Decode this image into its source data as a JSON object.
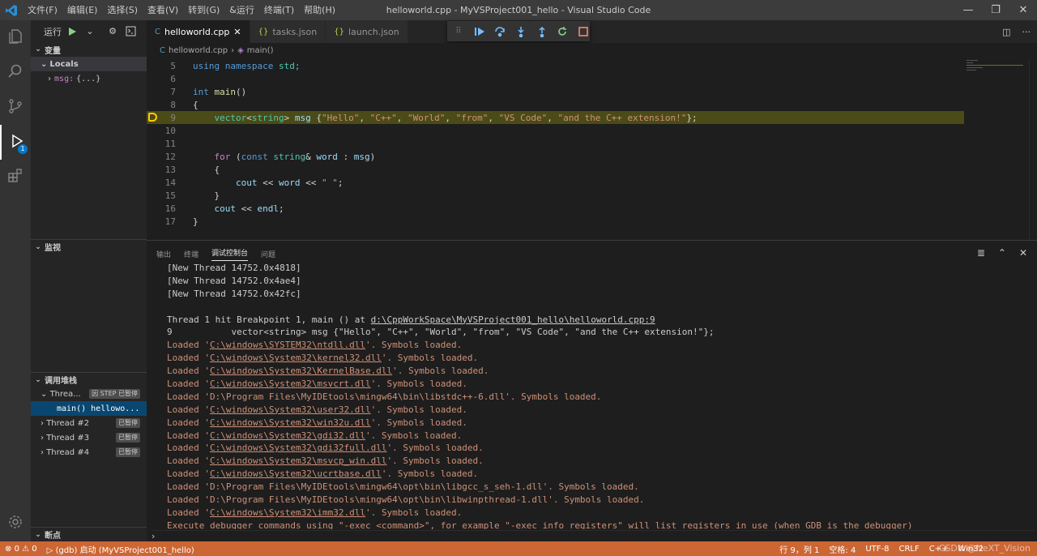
{
  "window": {
    "title": "helloworld.cpp - MyVSProject001_hello - Visual Studio Code",
    "menu": [
      "文件(F)",
      "编辑(E)",
      "选择(S)",
      "查看(V)",
      "转到(G)",
      "&运行",
      "终端(T)",
      "帮助(H)"
    ],
    "controls": {
      "minimize": "—",
      "maximize": "❐",
      "close": "✕"
    }
  },
  "activity": {
    "debug_badge": "1"
  },
  "sidebar": {
    "run_label": "运行",
    "variables_title": "变量",
    "locals_label": "Locals",
    "msg_name": "msg:",
    "msg_value": "{...}",
    "watch_title": "监视",
    "callstack_title": "调用堆栈",
    "threads": [
      {
        "label": "Threa...",
        "status": "因 STEP 已暂停"
      },
      {
        "label": "Thread #2",
        "status": "已暂停"
      },
      {
        "label": "Thread #3",
        "status": "已暂停"
      },
      {
        "label": "Thread #4",
        "status": "已暂停"
      }
    ],
    "frame_fn": "main()",
    "frame_file": "hellowo...",
    "breakpoints_title": "断点"
  },
  "tabs": [
    {
      "label": "helloworld.cpp",
      "icon": "C++",
      "active": true
    },
    {
      "label": "tasks.json",
      "icon": "{}"
    },
    {
      "label": "launch.json",
      "icon": "{}"
    }
  ],
  "breadcrumb": {
    "file": "helloworld.cpp",
    "symbol": "main()"
  },
  "editor": {
    "current_line": 9,
    "lines": [
      {
        "n": "5"
      },
      {
        "n": "6"
      },
      {
        "n": "7"
      },
      {
        "n": "8"
      },
      {
        "n": "9"
      },
      {
        "n": "10"
      },
      {
        "n": "11"
      },
      {
        "n": "12"
      },
      {
        "n": "13"
      },
      {
        "n": "14"
      },
      {
        "n": "15"
      },
      {
        "n": "16"
      },
      {
        "n": "17"
      }
    ],
    "tokens": {
      "l5_a": "using",
      "l5_b": "namespace",
      "l5_c": "std;",
      "l7_a": "int",
      "l7_b": "main",
      "l9_a": "vector",
      "l9_b": "string",
      "l9_c": "msg",
      "l9_s1": "\"Hello\"",
      "l9_s2": "\"C++\"",
      "l9_s3": "\"World\"",
      "l9_s4": "\"from\"",
      "l9_s5": "\"VS Code\"",
      "l9_s6": "\"and the C++ extension!\"",
      "l12_a": "for",
      "l12_b": "const",
      "l12_c": "string",
      "l12_d": "word",
      "l12_e": "msg",
      "l14_a": "cout",
      "l14_b": "word",
      "l14_s": "\" \"",
      "l16_a": "cout",
      "l16_b": "endl"
    }
  },
  "panel": {
    "tabs": [
      "输出",
      "终端",
      "调试控制台",
      "问题"
    ],
    "active_tab": "调试控制台",
    "console": [
      {
        "text": "[New Thread 14752.0x4818]",
        "color": "white"
      },
      {
        "text": "[New Thread 14752.0x4ae4]",
        "color": "white"
      },
      {
        "text": "[New Thread 14752.0x42fc]",
        "color": "white"
      },
      {
        "text": "",
        "color": "white"
      },
      {
        "text": "Thread 1 hit Breakpoint 1, main () at ",
        "link": "d:\\CppWorkSpace\\MyVSProject001_hello\\helloworld.cpp:9",
        "color": "white"
      },
      {
        "text": "9\t    vector<string> msg {\"Hello\", \"C++\", \"World\", \"from\", \"VS Code\", \"and the C++ extension!\"};",
        "color": "white"
      },
      {
        "pre": "Loaded '",
        "link": "C:\\windows\\SYSTEM32\\ntdll.dll",
        "post": "'. Symbols loaded.",
        "color": "orange"
      },
      {
        "pre": "Loaded '",
        "link": "C:\\windows\\System32\\kernel32.dll",
        "post": "'. Symbols loaded.",
        "color": "orange"
      },
      {
        "pre": "Loaded '",
        "link": "C:\\windows\\System32\\KernelBase.dll",
        "post": "'. Symbols loaded.",
        "color": "orange"
      },
      {
        "pre": "Loaded '",
        "link": "C:\\windows\\System32\\msvcrt.dll",
        "post": "'. Symbols loaded.",
        "color": "orange"
      },
      {
        "pre": "Loaded 'D:\\Program Files\\MyIDEtools\\mingw64\\bin\\libstdc++-6.dll'. Symbols loaded.",
        "link": "",
        "post": "",
        "color": "orange"
      },
      {
        "pre": "Loaded '",
        "link": "C:\\windows\\System32\\user32.dll",
        "post": "'. Symbols loaded.",
        "color": "orange"
      },
      {
        "pre": "Loaded '",
        "link": "C:\\windows\\System32\\win32u.dll",
        "post": "'. Symbols loaded.",
        "color": "orange"
      },
      {
        "pre": "Loaded '",
        "link": "C:\\windows\\System32\\gdi32.dll",
        "post": "'. Symbols loaded.",
        "color": "orange"
      },
      {
        "pre": "Loaded '",
        "link": "C:\\windows\\System32\\gdi32full.dll",
        "post": "'. Symbols loaded.",
        "color": "orange"
      },
      {
        "pre": "Loaded '",
        "link": "C:\\windows\\System32\\msvcp_win.dll",
        "post": "'. Symbols loaded.",
        "color": "orange"
      },
      {
        "pre": "Loaded '",
        "link": "C:\\windows\\System32\\ucrtbase.dll",
        "post": "'. Symbols loaded.",
        "color": "orange"
      },
      {
        "pre": "Loaded 'D:\\Program Files\\MyIDEtools\\mingw64\\opt\\bin\\libgcc_s_seh-1.dll'. Symbols loaded.",
        "link": "",
        "post": "",
        "color": "orange"
      },
      {
        "pre": "Loaded 'D:\\Program Files\\MyIDEtools\\mingw64\\opt\\bin\\libwinpthread-1.dll'. Symbols loaded.",
        "link": "",
        "post": "",
        "color": "orange"
      },
      {
        "pre": "Loaded '",
        "link": "C:\\windows\\System32\\imm32.dll",
        "post": "'. Symbols loaded.",
        "color": "orange"
      },
      {
        "pre": "Execute debugger commands using \"-exec <command>\", for example \"-exec info registers\" will list registers in use (when GDB is the debugger)",
        "link": "",
        "post": "",
        "color": "orange"
      }
    ],
    "prompt": "›"
  },
  "statusbar": {
    "errors": "0",
    "warnings": "0",
    "launch": "(gdb) 启动 (MyVSProject001_hello)",
    "position": "行 9，列 1",
    "spaces": "空格: 4",
    "encoding": "UTF-8",
    "eol": "CRLF",
    "language": "C++",
    "platform": "Win32",
    "watermark": "CSDN @NeXT_Vision"
  },
  "colors": {
    "statusbar": "#cc6633",
    "accent": "#007acc",
    "highlight": "#4b4b18",
    "breakpoint": "#ffcc00"
  }
}
